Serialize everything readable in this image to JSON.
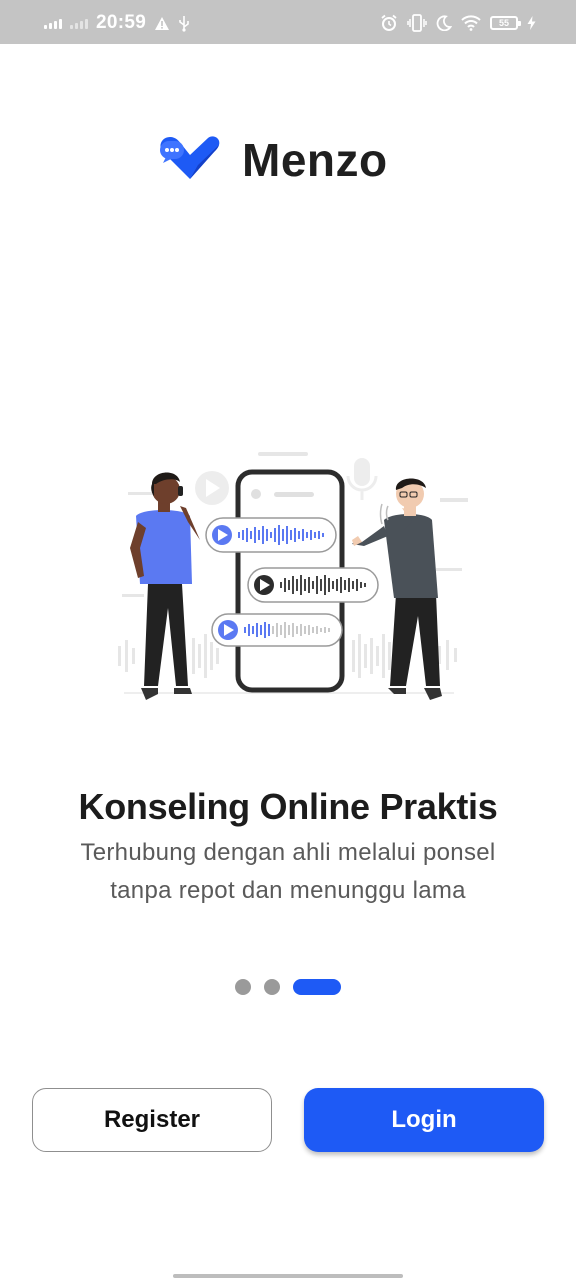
{
  "status_bar": {
    "time": "20:59",
    "battery": "55",
    "icons": [
      "signal-icon",
      "signal-icon",
      "alert-icon",
      "usb-icon",
      "alarm-icon",
      "vibrate-icon",
      "moon-icon",
      "wifi-icon",
      "battery-icon",
      "charging-icon"
    ]
  },
  "brand": {
    "name": "Menzo",
    "logo_icon": "heart-chat-icon",
    "color": "#1e5af5"
  },
  "illustration": {
    "name": "voice-chat-illustration",
    "accent": "#5b79f2"
  },
  "onboarding": {
    "title": "Konseling Online Praktis",
    "subtitle_line1": "Terhubung dengan ahli melalui ponsel",
    "subtitle_line2": "tanpa repot dan menunggu lama",
    "pages_total": 3,
    "active_page": 3
  },
  "actions": {
    "register_label": "Register",
    "login_label": "Login",
    "primary_color": "#1e5af5"
  }
}
